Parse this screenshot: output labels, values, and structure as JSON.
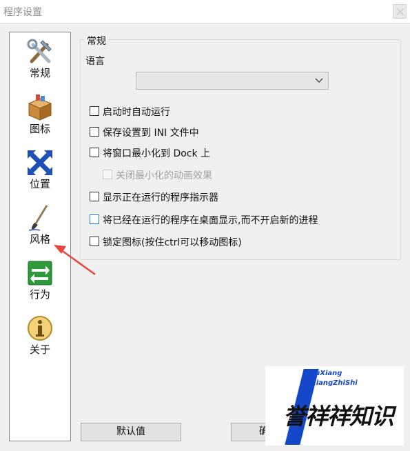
{
  "window": {
    "title": "程序设置"
  },
  "sidebar": {
    "items": [
      {
        "label": "常规",
        "icon": "tools-icon"
      },
      {
        "label": "图标",
        "icon": "box-icon"
      },
      {
        "label": "位置",
        "icon": "move-arrows-icon"
      },
      {
        "label": "风格",
        "icon": "paintbrush-icon"
      },
      {
        "label": "行为",
        "icon": "exchange-arrows-icon"
      },
      {
        "label": "关于",
        "icon": "info-icon"
      }
    ]
  },
  "general": {
    "group_title": "常规",
    "language_label": "语言",
    "language_value": "",
    "options": [
      {
        "label": "启动时自动运行",
        "checked": false,
        "enabled": true
      },
      {
        "label": "保存设置到 INI 文件中",
        "checked": false,
        "enabled": true
      },
      {
        "label": "将窗口最小化到 Dock 上",
        "checked": false,
        "enabled": true
      },
      {
        "label": "关闭最小化的动画效果",
        "checked": false,
        "enabled": false
      },
      {
        "label": "显示正在运行的程序指示器",
        "checked": false,
        "enabled": true
      },
      {
        "label": "将已经在运行的程序在桌面显示,而不开启新的进程",
        "checked": false,
        "enabled": true
      },
      {
        "label": "锁定图标(按住ctrl可以移动图标)",
        "checked": false,
        "enabled": true
      }
    ]
  },
  "buttons": {
    "default_label": "默认值",
    "ok_label": "确"
  },
  "watermark": {
    "pinyin_line1": "YuXiang",
    "pinyin_line2": "XiangZhiShi",
    "text": "誉祥祥知识"
  },
  "colors": {
    "accent_blue": "#1e7bd6",
    "annotation_red": "#e8453c",
    "brand_blue": "#1447c9"
  }
}
